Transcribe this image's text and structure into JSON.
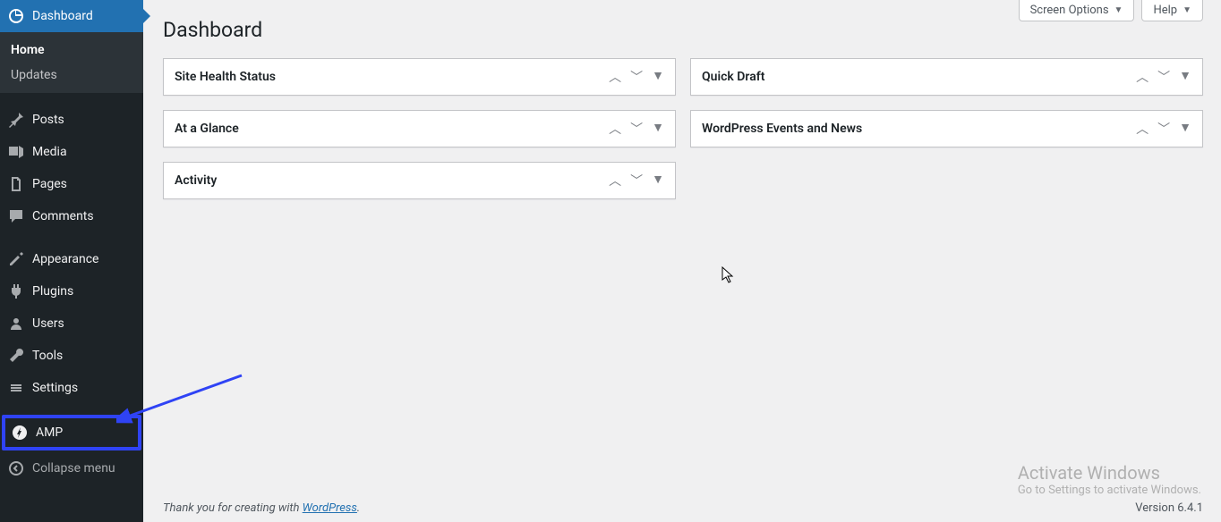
{
  "sidebar": {
    "dashboard": {
      "label": "Dashboard"
    },
    "submenu": {
      "home": "Home",
      "updates": "Updates"
    },
    "posts": "Posts",
    "media": "Media",
    "pages": "Pages",
    "comments": "Comments",
    "appearance": "Appearance",
    "plugins": "Plugins",
    "users": "Users",
    "tools": "Tools",
    "settings": "Settings",
    "amp": "AMP",
    "collapse": "Collapse menu"
  },
  "top": {
    "screen_options": "Screen Options",
    "help": "Help"
  },
  "page_title": "Dashboard",
  "boxes": {
    "site_health": "Site Health Status",
    "at_a_glance": "At a Glance",
    "activity": "Activity",
    "quick_draft": "Quick Draft",
    "events_news": "WordPress Events and News"
  },
  "footer": {
    "thanks_prefix": "Thank you for creating with ",
    "thanks_link": "WordPress",
    "thanks_suffix": ".",
    "version": "Version 6.4.1"
  },
  "watermark": {
    "title": "Activate Windows",
    "sub": "Go to Settings to activate Windows."
  }
}
